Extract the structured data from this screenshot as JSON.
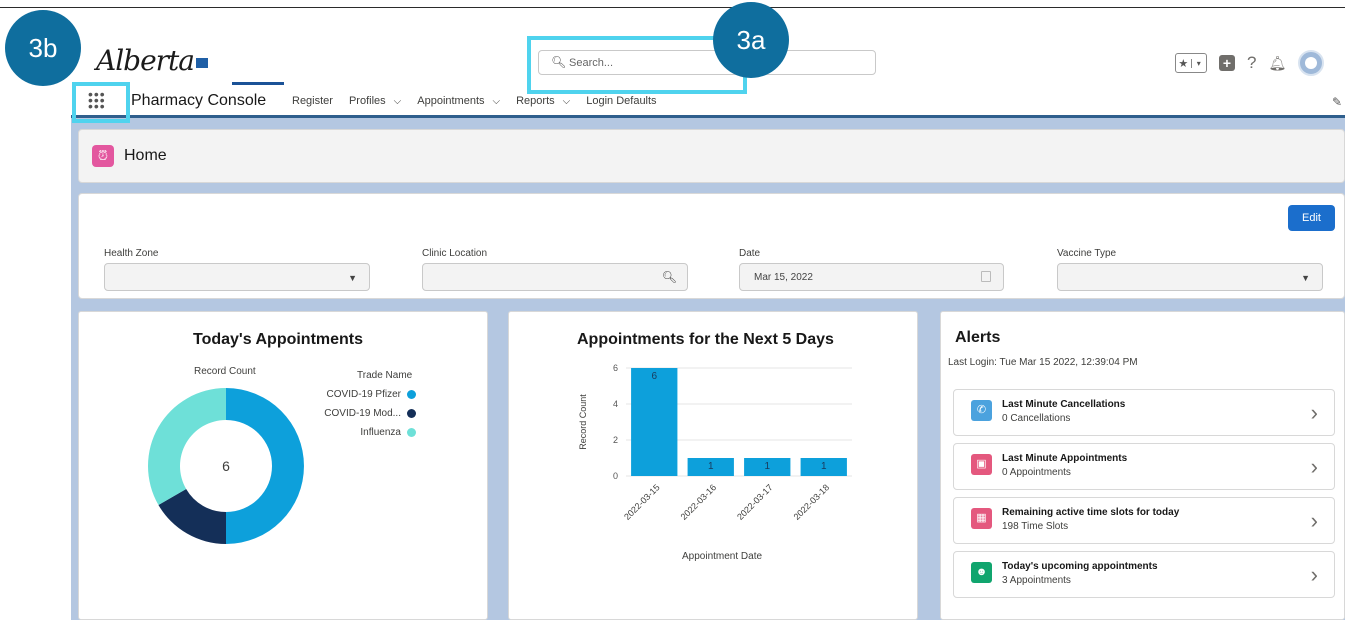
{
  "header": {
    "logo_text": "Alberta",
    "search_placeholder": "Search...",
    "app_name": "Pharmacy Console"
  },
  "nav": {
    "items": [
      {
        "label": "Register",
        "dropdown": false
      },
      {
        "label": "Profiles",
        "dropdown": true
      },
      {
        "label": "Appointments",
        "dropdown": true
      },
      {
        "label": "Reports",
        "dropdown": true
      },
      {
        "label": "Login Defaults",
        "dropdown": false
      }
    ]
  },
  "page": {
    "title": "Home"
  },
  "filters": {
    "edit_label": "Edit",
    "health_zone": {
      "label": "Health Zone",
      "value": ""
    },
    "clinic_location": {
      "label": "Clinic Location",
      "value": ""
    },
    "date": {
      "label": "Date",
      "value": "Mar 15, 2022"
    },
    "vaccine_type": {
      "label": "Vaccine Type",
      "value": ""
    }
  },
  "todays_appointments": {
    "title": "Today's Appointments",
    "record_count_label": "Record Count",
    "legend_title": "Trade Name",
    "center_value": "6",
    "chart_data": {
      "type": "pie",
      "donut": true,
      "total": 6,
      "categories": [
        "COVID-19 Pfizer",
        "COVID-19 Mod...",
        "Influenza"
      ],
      "values": [
        3,
        1,
        2
      ],
      "colors": [
        "#0da0db",
        "#142f58",
        "#6ee0d8"
      ]
    }
  },
  "next5": {
    "title": "Appointments for the Next 5 Days",
    "ylabel": "Record Count",
    "xlabel": "Appointment Date",
    "chart_data": {
      "type": "bar",
      "categories": [
        "2022-03-15",
        "2022-03-16",
        "2022-03-17",
        "2022-03-18"
      ],
      "values": [
        6,
        1,
        1,
        1
      ],
      "yticks": [
        0,
        2,
        4,
        6
      ],
      "ylim": [
        0,
        6
      ],
      "color": "#0da0db"
    }
  },
  "alerts": {
    "title": "Alerts",
    "last_login": "Last Login: Tue Mar 15 2022, 12:39:04 PM",
    "items": [
      {
        "title": "Last Minute Cancellations",
        "subtitle": "0 Cancellations",
        "icon": "megaphone-icon",
        "color": "#4ba2de"
      },
      {
        "title": "Last Minute Appointments",
        "subtitle": "0 Appointments",
        "icon": "calendar-x-icon",
        "color": "#e4587e"
      },
      {
        "title": "Remaining active time slots for today",
        "subtitle": "198 Time Slots",
        "icon": "calendar-grid-icon",
        "color": "#e4587e"
      },
      {
        "title": "Today's upcoming appointments",
        "subtitle": "3 Appointments",
        "icon": "people-icon",
        "color": "#10a56e"
      }
    ]
  },
  "callouts": {
    "a": "3a",
    "b": "3b"
  }
}
